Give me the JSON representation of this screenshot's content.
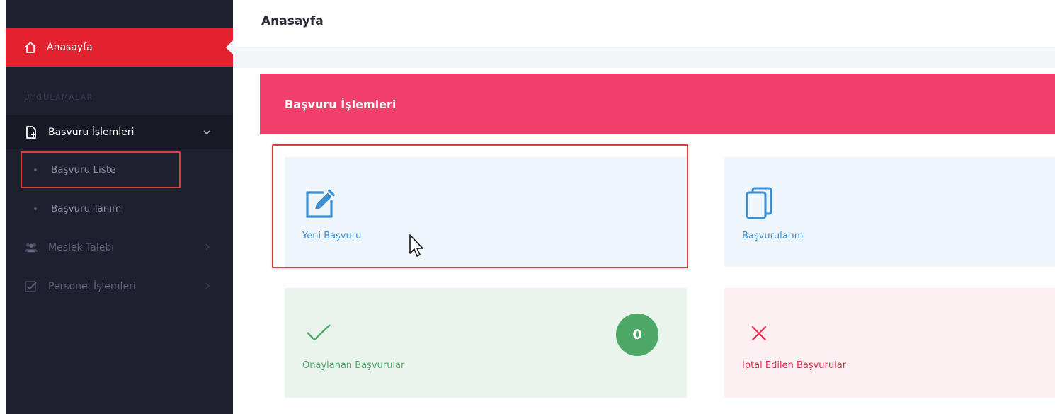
{
  "sidebar": {
    "home_label": "Anasayfa",
    "section_label": "UYGULAMALAR",
    "items": [
      {
        "label": "Başvuru İşlemleri",
        "icon": "file-plus-icon",
        "expanded": true
      },
      {
        "label": "Meslek Talebi",
        "icon": "users-icon",
        "expanded": false
      },
      {
        "label": "Personel İşlemleri",
        "icon": "checklist-icon",
        "expanded": false
      }
    ],
    "subitems": [
      {
        "label": "Başvuru Liste",
        "highlighted": true
      },
      {
        "label": "Başvuru Tanım",
        "highlighted": false
      }
    ]
  },
  "page": {
    "title": "Anasayfa"
  },
  "banner": {
    "title": "Başvuru İşlemleri"
  },
  "cards": {
    "new_application": {
      "label": "Yeni Başvuru",
      "icon": "edit-icon"
    },
    "my_applications": {
      "label": "Başvurularım",
      "icon": "copy-icon"
    },
    "approved": {
      "label": "Onaylanan Başvurular",
      "icon": "check-icon",
      "count": "0"
    },
    "cancelled": {
      "label": "İptal Edilen Başvurular",
      "icon": "close-icon"
    }
  },
  "colors": {
    "sidebar_bg": "#1e2030",
    "active_red": "#e4222f",
    "banner_pink": "#ef3f6a",
    "card_blue": "#eef6fc",
    "card_green": "#e9f4ec",
    "card_pink": "#fdf0f3",
    "accent_blue": "#3d8fd1",
    "success_green": "#4ea868",
    "danger_red": "#e8294c",
    "highlight_border": "#dc3d3a"
  }
}
